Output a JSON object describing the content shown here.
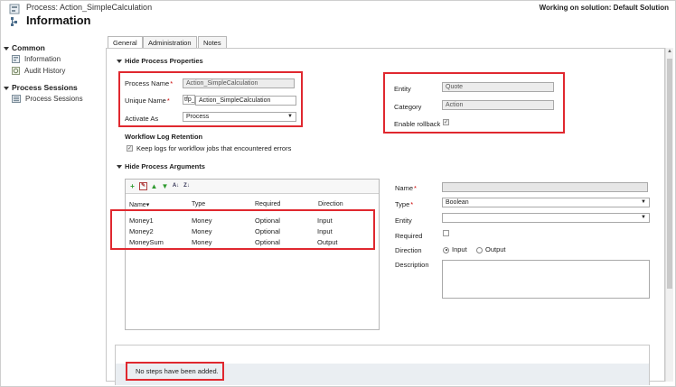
{
  "header": {
    "subtitle": "Process: Action_SimpleCalculation",
    "title": "Information",
    "solution": "Working on solution: Default Solution"
  },
  "nav": {
    "common_label": "Common",
    "common_items": [
      {
        "label": "Information",
        "icon": "information-icon"
      },
      {
        "label": "Audit History",
        "icon": "audit-history-icon"
      }
    ],
    "process_sessions_label": "Process Sessions",
    "process_sessions_items": [
      {
        "label": "Process Sessions",
        "icon": "process-sessions-icon"
      }
    ]
  },
  "tabs": [
    {
      "label": "General",
      "active": true
    },
    {
      "label": "Administration",
      "active": false
    },
    {
      "label": "Notes",
      "active": false
    }
  ],
  "properties": {
    "section_label": "Hide Process Properties",
    "process_name_label": "Process Name",
    "process_name_value": "Action_SimpleCalculation",
    "unique_name_label": "Unique Name",
    "unique_name_prefix": "tfp_",
    "unique_name_value": "Action_SimpleCalculation",
    "activate_as_label": "Activate As",
    "activate_as_value": "Process",
    "entity_label": "Entity",
    "entity_value": "Quote",
    "category_label": "Category",
    "category_value": "Action",
    "enable_rollback_label": "Enable rollback",
    "enable_rollback_checked": true
  },
  "workflow_log": {
    "title": "Workflow Log Retention",
    "keep_logs_label": "Keep logs for workflow jobs that encountered errors",
    "keep_logs_checked": true
  },
  "arguments": {
    "section_label": "Hide Process Arguments",
    "columns": [
      "Name",
      "Type",
      "Required",
      "Direction"
    ],
    "rows": [
      {
        "name": "Money1",
        "type": "Money",
        "required": "Optional",
        "direction": "Input"
      },
      {
        "name": "Money2",
        "type": "Money",
        "required": "Optional",
        "direction": "Input"
      },
      {
        "name": "MoneySum",
        "type": "Money",
        "required": "Optional",
        "direction": "Output"
      }
    ]
  },
  "arg_detail": {
    "name_label": "Name",
    "name_value": "",
    "type_label": "Type",
    "type_value": "Boolean",
    "entity_label": "Entity",
    "entity_value": "",
    "required_label": "Required",
    "direction_label": "Direction",
    "direction_input": "Input",
    "direction_output": "Output",
    "description_label": "Description"
  },
  "steps": {
    "empty_message": "No steps have been added."
  },
  "colors": {
    "highlight_red": "#e0282f",
    "field_grey": "#ececec",
    "required_red": "#cc0000"
  }
}
